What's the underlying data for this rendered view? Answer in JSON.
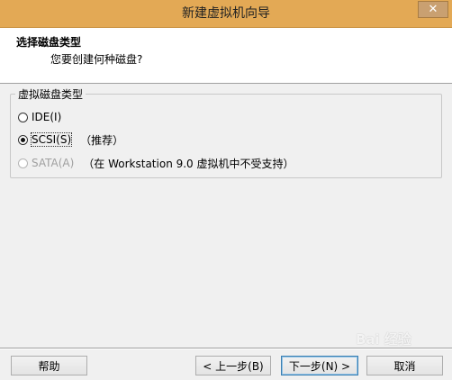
{
  "window": {
    "title": "新建虚拟机向导",
    "close_label": "✕"
  },
  "header": {
    "title": "选择磁盘类型",
    "subtitle": "您要创建何种磁盘?"
  },
  "disk_type": {
    "group_label": "虚拟磁盘类型",
    "options": [
      {
        "label": "IDE(I)",
        "selected": false,
        "enabled": true,
        "note": ""
      },
      {
        "label": "SCSI(S)",
        "selected": true,
        "enabled": true,
        "note": "（推荐）"
      },
      {
        "label": "SATA(A)",
        "selected": false,
        "enabled": false,
        "note": "（在 Workstation 9.0 虚拟机中不受支持）"
      }
    ]
  },
  "buttons": {
    "help": "帮助",
    "back": "< 上一步(B)",
    "next": "下一步(N) >",
    "cancel": "取消"
  },
  "watermark": "Bai 经验"
}
